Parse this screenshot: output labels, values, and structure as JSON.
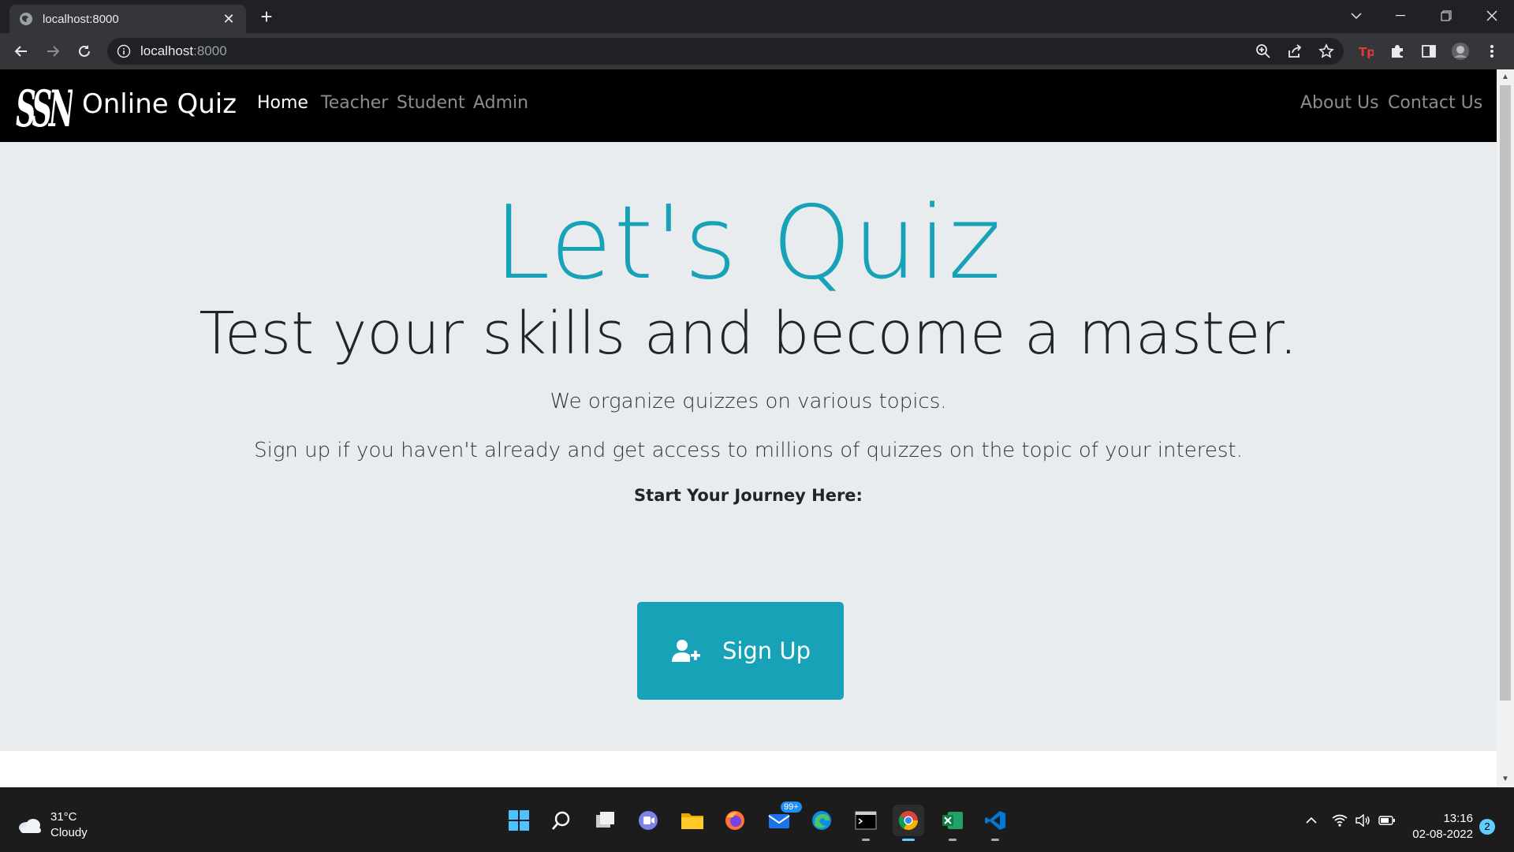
{
  "browser": {
    "tab_title": "localhost:8000",
    "tab_close": "✕",
    "new_tab": "+",
    "url_host": "localhost",
    "url_port": ":8000"
  },
  "site": {
    "brand": "Online Quiz",
    "logo_text": "SSN",
    "nav_left": [
      "Home",
      "Teacher",
      "Student",
      "Admin"
    ],
    "nav_right": [
      "About Us",
      "Contact Us"
    ],
    "active_nav": "Home"
  },
  "hero": {
    "title": "Let's Quiz",
    "subtitle": "Test your skills and become a master.",
    "line1": "We organize quizzes on various topics.",
    "line2": "Sign up if you haven't already and get access to millions of quizzes on the topic of your interest.",
    "journey": "Start Your Journey Here:",
    "signup_label": "Sign Up"
  },
  "taskbar": {
    "temperature": "31°C",
    "weather": "Cloudy",
    "mail_badge": "99+",
    "time": "13:16",
    "date": "02-08-2022",
    "notifications": "2"
  },
  "colors": {
    "accent": "#17a2b8",
    "navbar": "#000000",
    "jumbotron": "#e9ecef"
  }
}
